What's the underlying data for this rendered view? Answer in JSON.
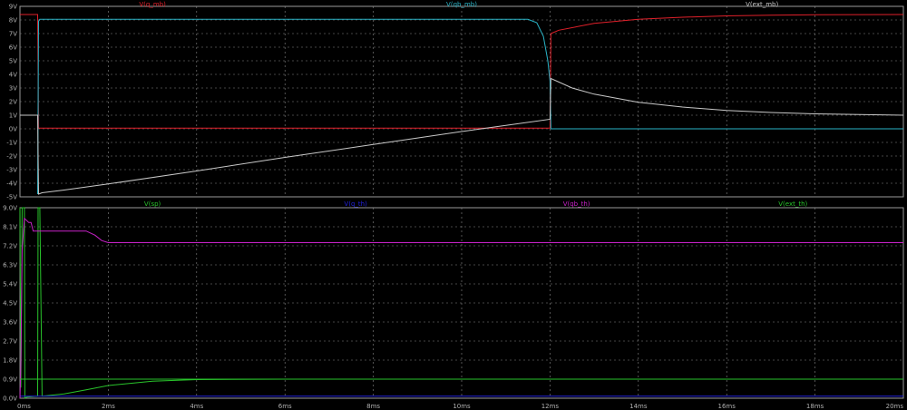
{
  "window": {
    "background": "#000000"
  },
  "chart_data": [
    {
      "type": "line",
      "panel": "top",
      "ylim": [
        -5,
        9
      ],
      "yticks": [
        {
          "v": 9,
          "label": "9V"
        },
        {
          "v": 8,
          "label": "8V"
        },
        {
          "v": 7,
          "label": "7V"
        },
        {
          "v": 6,
          "label": "6V"
        },
        {
          "v": 5,
          "label": "5V"
        },
        {
          "v": 4,
          "label": "4V"
        },
        {
          "v": 3,
          "label": "3V"
        },
        {
          "v": 2,
          "label": "2V"
        },
        {
          "v": 1,
          "label": "1V"
        },
        {
          "v": 0,
          "label": "0V"
        },
        {
          "v": -1,
          "label": "-1V"
        },
        {
          "v": -2,
          "label": "-2V"
        },
        {
          "v": -3,
          "label": "-3V"
        },
        {
          "v": -4,
          "label": "-4V"
        },
        {
          "v": -5,
          "label": "-5V"
        }
      ],
      "series": [
        {
          "name": "V(q_mb)",
          "color": "#e0202a",
          "legend_t": 3.0,
          "t": [
            0,
            0.4,
            0.42,
            0.5,
            12.0,
            12.02,
            12.2,
            13.0,
            14.0,
            15.0,
            16.0,
            17.0,
            18.0,
            20.0
          ],
          "v": [
            8.4,
            8.4,
            0.05,
            0.05,
            0.05,
            7.0,
            7.25,
            7.75,
            8.05,
            8.2,
            8.3,
            8.35,
            8.38,
            8.4
          ]
        },
        {
          "name": "V(qb_mb)",
          "color": "#2ab3c6",
          "legend_t": 10.0,
          "t": [
            0.4,
            0.42,
            0.45,
            11.5,
            11.7,
            11.85,
            11.95,
            12.0,
            12.02,
            20.0
          ],
          "v": [
            -4.8,
            7.9,
            8.05,
            8.05,
            7.8,
            6.8,
            5.0,
            3.5,
            0.0,
            0.0
          ]
        },
        {
          "name": "V(ext_mb)",
          "color": "#c8c8c8",
          "legend_t": 16.8,
          "t": [
            0,
            0.4,
            0.42,
            0.5,
            1,
            2,
            4,
            6,
            8,
            10,
            11,
            12.0,
            12.02,
            12.5,
            13,
            14,
            15,
            16,
            17,
            18,
            19,
            20
          ],
          "v": [
            1.0,
            1.0,
            -4.8,
            -4.7,
            -4.5,
            -4.05,
            -3.1,
            -2.1,
            -1.15,
            -0.2,
            0.25,
            0.7,
            3.7,
            3.0,
            2.55,
            1.95,
            1.6,
            1.35,
            1.2,
            1.1,
            1.05,
            1.0
          ]
        }
      ]
    },
    {
      "type": "line",
      "panel": "bottom",
      "ylim": [
        0,
        9
      ],
      "yticks": [
        {
          "v": 9.0,
          "label": "9.0V"
        },
        {
          "v": 8.1,
          "label": "8.1V"
        },
        {
          "v": 7.2,
          "label": "7.2V"
        },
        {
          "v": 6.3,
          "label": "6.3V"
        },
        {
          "v": 5.4,
          "label": "5.4V"
        },
        {
          "v": 4.5,
          "label": "4.5V"
        },
        {
          "v": 3.6,
          "label": "3.6V"
        },
        {
          "v": 2.7,
          "label": "2.7V"
        },
        {
          "v": 1.8,
          "label": "1.8V"
        },
        {
          "v": 0.9,
          "label": "0.9V"
        },
        {
          "v": 0.0,
          "label": "0.0V"
        }
      ],
      "series": [
        {
          "name": "V(sp)",
          "color": "#29c42b",
          "legend_t": 3.0,
          "t": [
            0,
            0.02,
            0.05,
            0.1,
            0.11,
            0.15,
            0.4,
            0.41,
            0.45,
            0.5,
            1,
            1.5,
            2,
            3,
            4,
            6,
            8,
            10,
            12,
            14,
            16,
            18,
            20
          ],
          "v": [
            9.0,
            0.5,
            9.0,
            9.0,
            0.0,
            0.05,
            0.1,
            9.0,
            9.0,
            0.1,
            0.2,
            0.4,
            0.6,
            0.8,
            0.88,
            0.9,
            0.9,
            0.9,
            0.9,
            0.9,
            0.9,
            0.9,
            0.9
          ]
        },
        {
          "name": "V(q_th)",
          "color": "#2222dd",
          "legend_t": 7.6,
          "t": [
            0,
            20
          ],
          "v": [
            0.1,
            0.1
          ]
        },
        {
          "name": "V(qb_th)",
          "color": "#c822c8",
          "legend_t": 12.6,
          "t": [
            0,
            0.02,
            0.05,
            0.1,
            0.2,
            0.25,
            0.3,
            0.5,
            1.0,
            1.5,
            1.7,
            1.85,
            2.0,
            3,
            6,
            10,
            14,
            18,
            20
          ],
          "v": [
            0.0,
            1.5,
            7.0,
            8.5,
            8.3,
            8.3,
            7.9,
            7.9,
            7.9,
            7.9,
            7.7,
            7.45,
            7.35,
            7.35,
            7.35,
            7.35,
            7.35,
            7.35,
            7.35
          ]
        },
        {
          "name": "V(ext_th)",
          "color": "#29c42b",
          "legend_t": 17.5,
          "t": [
            0,
            20
          ],
          "v": [
            0.9,
            0.9
          ]
        }
      ]
    }
  ],
  "x_axis": {
    "xlim": [
      0,
      20
    ],
    "ticks": [
      {
        "v": 0,
        "label": "0ms"
      },
      {
        "v": 2,
        "label": "2ms"
      },
      {
        "v": 4,
        "label": "4ms"
      },
      {
        "v": 6,
        "label": "6ms"
      },
      {
        "v": 8,
        "label": "8ms"
      },
      {
        "v": 10,
        "label": "10ms"
      },
      {
        "v": 12,
        "label": "12ms"
      },
      {
        "v": 14,
        "label": "14ms"
      },
      {
        "v": 16,
        "label": "16ms"
      },
      {
        "v": 18,
        "label": "18ms"
      },
      {
        "v": 20,
        "label": "20ms"
      }
    ]
  }
}
